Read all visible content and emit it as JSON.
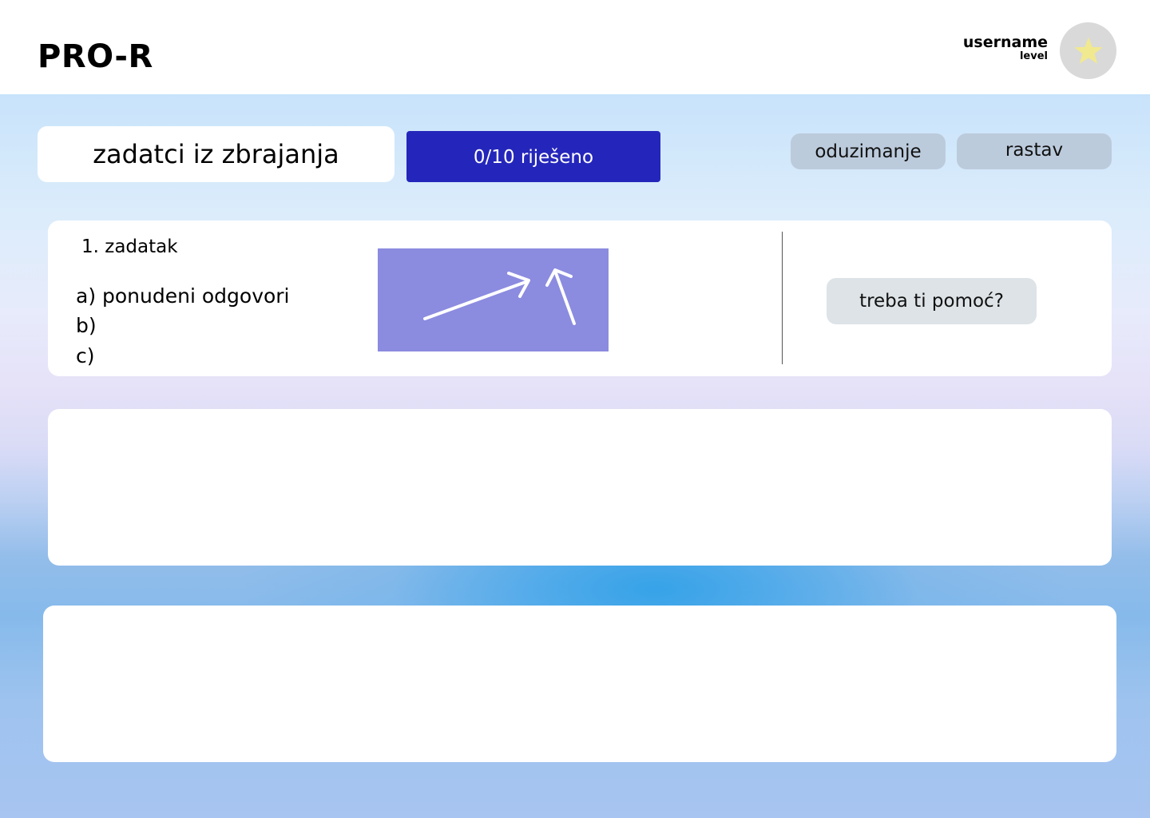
{
  "header": {
    "logo": "PRO-R",
    "username": "username",
    "level": "level",
    "avatar_icon": "star-icon",
    "avatar_star_color": "#f1e98f",
    "avatar_bg_color": "#d9d9d9"
  },
  "toolbar": {
    "title": "zadatci iz zbrajanja",
    "progress_label": "0/10 riješeno",
    "progress_solved": 0,
    "progress_total": 10,
    "progress_color": "#2426bb",
    "tabs": [
      {
        "label": "oduzimanje"
      },
      {
        "label": "rastav"
      }
    ]
  },
  "task": {
    "title": "1. zadatak",
    "answers": [
      {
        "label": "a) ponudeni odgovori"
      },
      {
        "label": "b)"
      },
      {
        "label": "c)"
      }
    ],
    "image_icon": "arrows-icon",
    "image_bg_color": "#8b8be0",
    "help_label": "treba ti pomoć?"
  }
}
